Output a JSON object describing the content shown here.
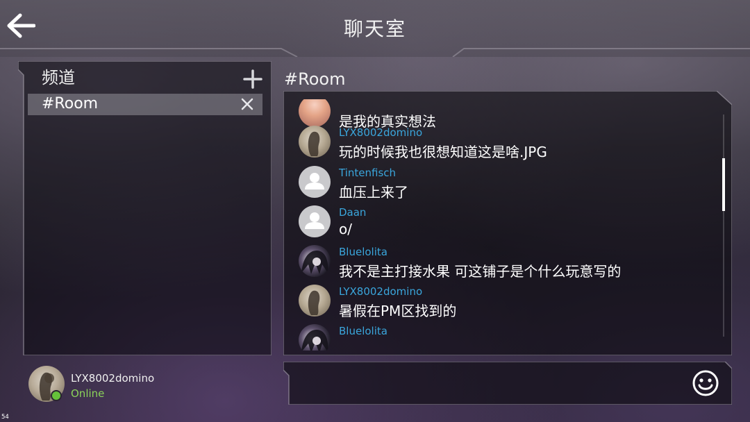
{
  "header": {
    "title": "聊天室"
  },
  "channels": {
    "title": "频道",
    "items": [
      {
        "label": "#Room"
      }
    ]
  },
  "user": {
    "name": "LYX8002domino",
    "status": "Online"
  },
  "room": {
    "title": "#Room"
  },
  "messages": [
    {
      "name": "",
      "text": "是我的真实想法",
      "avatar": "pink"
    },
    {
      "name": "LYX8002domino",
      "text": "玩的时候我也很想知道这是啥.JPG",
      "avatar": "lyx"
    },
    {
      "name": "Tintenfisch",
      "text": "血压上来了",
      "avatar": "default"
    },
    {
      "name": "Daan",
      "text": "o/",
      "avatar": "default"
    },
    {
      "name": "Bluelolita",
      "text": "我不是主打接水果 可这铺子是个什么玩意写的",
      "avatar": "blue"
    },
    {
      "name": "LYX8002domino",
      "text": "暑假在PM区找到的",
      "avatar": "lyx"
    },
    {
      "name": "Bluelolita",
      "text": "",
      "avatar": "blue"
    }
  ],
  "input": {
    "value": "",
    "placeholder": ""
  },
  "debug": {
    "fps": "54"
  },
  "colors": {
    "username": "#3aa6dc",
    "online": "#8bd35a",
    "selected_channel": "rgba(230,230,235,0.30)"
  },
  "icons": {
    "back": "arrow-left-icon",
    "add": "plus-icon",
    "close": "close-icon",
    "emoji": "smiley-icon",
    "default_avatar": "user-silhouette-icon"
  }
}
